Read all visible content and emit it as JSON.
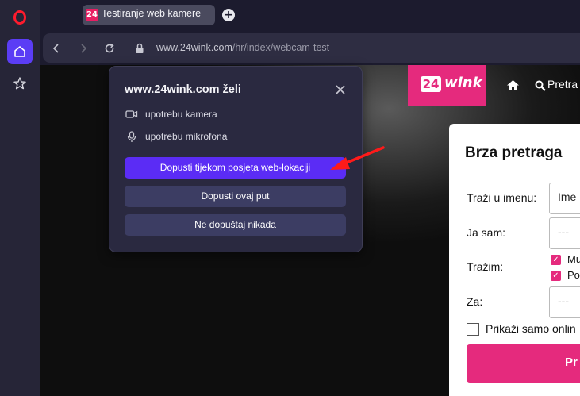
{
  "browser": {
    "tab_title": "Testiranje web kamere",
    "tab_favicon": "24",
    "new_tab_label": "+",
    "url_host": "www.24wink.com",
    "url_path": "/hr/index/webcam-test"
  },
  "sidebar": {
    "items": [
      {
        "name": "opera-logo"
      },
      {
        "name": "home-icon"
      },
      {
        "name": "star-icon"
      }
    ]
  },
  "popup": {
    "title": "www.24wink.com želi",
    "permissions": [
      {
        "icon": "camera-icon",
        "label": "upotrebu kamera"
      },
      {
        "icon": "microphone-icon",
        "label": "upotrebu mikrofona"
      }
    ],
    "buttons": {
      "allow_site": "Dopusti tijekom posjeta web-lokaciji",
      "allow_once": "Dopusti ovaj put",
      "never": "Ne dopuštaj nikada"
    }
  },
  "site": {
    "logo_number": "24",
    "logo_word": "wink",
    "nav_search": "Pretra",
    "search_panel": {
      "title": "Brza pretraga",
      "name_label": "Traži u imenu:",
      "name_placeholder": "Ime",
      "i_am_label": "Ja sam:",
      "i_am_value": "---",
      "seeking_label": "Tražim:",
      "seeking_options": [
        "Mu",
        "Po"
      ],
      "for_label": "Za:",
      "for_value": "---",
      "online_only_label": "Prikaži samo onlin",
      "submit_label": "Pr"
    }
  },
  "colors": {
    "accent_pink": "#e52a7d",
    "opera_purple": "#5b2cf5",
    "popup_bg": "#2a2940"
  }
}
